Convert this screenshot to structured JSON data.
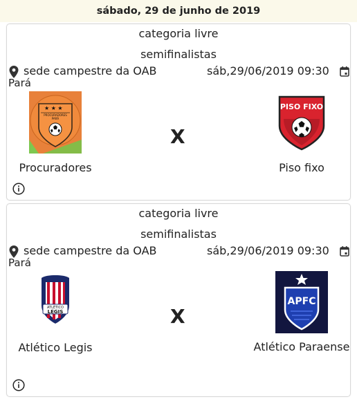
{
  "header": {
    "date": "sábado, 29 de junho de 2019"
  },
  "matches": [
    {
      "category": "categoria livre",
      "phase": "semifinalistas",
      "venue": "sede campestre da OAB",
      "city": "Pará",
      "datetime": "sáb,29/06/2019 09:30",
      "vs": "X",
      "home": {
        "name": "Procuradores",
        "logo": "procuradores-crest",
        "logo_text": "PROCURADORES PARÁ"
      },
      "away": {
        "name": "Piso fixo",
        "logo": "piso-fixo-crest",
        "logo_text": "PISO FIXO"
      }
    },
    {
      "category": "categoria livre",
      "phase": "semifinalistas",
      "venue": "sede campestre da OAB",
      "city": "Pará",
      "datetime": "sáb,29/06/2019 09:30",
      "vs": "X",
      "home": {
        "name": "Atlético Legis",
        "logo": "atletico-legis-crest",
        "logo_text": "ATLÉTICO LEGIS"
      },
      "away": {
        "name": "Atlético Paraense",
        "logo": "apfc-crest",
        "logo_text": "APFC"
      }
    }
  ],
  "colors": {
    "header_bg": "#fbf9ea",
    "procuradores_orange": "#e8813a",
    "piso_red": "#d9232e",
    "legis_red": "#c8102e",
    "legis_blue": "#1b2a6b",
    "apfc_navy": "#12163f"
  },
  "icons": [
    "map-pin-icon",
    "calendar-icon",
    "info-icon"
  ]
}
